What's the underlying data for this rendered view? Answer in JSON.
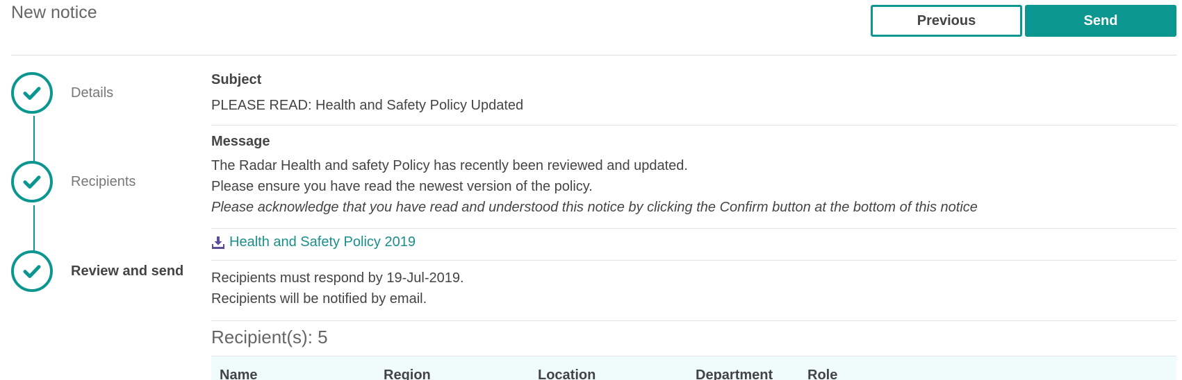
{
  "header": {
    "title": "New notice",
    "previous_label": "Previous",
    "send_label": "Send"
  },
  "stepper": {
    "steps": [
      {
        "label": "Details",
        "status": "complete"
      },
      {
        "label": "Recipients",
        "status": "complete"
      },
      {
        "label": "Review and send",
        "status": "current"
      }
    ]
  },
  "review": {
    "subject_label": "Subject",
    "subject_value": "PLEASE READ: Health and Safety Policy Updated",
    "message_label": "Message",
    "message_lines": [
      "The Radar Health and safety Policy has recently been reviewed and updated.",
      "Please ensure you have read the newest version of the policy.",
      "Please acknowledge that you have read and understood this notice by clicking the Confirm button at the bottom of this notice"
    ],
    "attachment": {
      "icon": "download-icon",
      "label": "Health and Safety Policy 2019"
    },
    "respond_by": "Recipients must respond by 19-Jul-2019.",
    "notify": "Recipients will be notified by email.",
    "recipient_count": "Recipient(s): 5"
  },
  "table": {
    "columns": [
      "Name",
      "Region",
      "Location",
      "Department",
      "Role"
    ]
  },
  "colors": {
    "accent": "#0b9790",
    "link": "#1a8f8a",
    "table_header_bg": "#f0fcfc"
  }
}
